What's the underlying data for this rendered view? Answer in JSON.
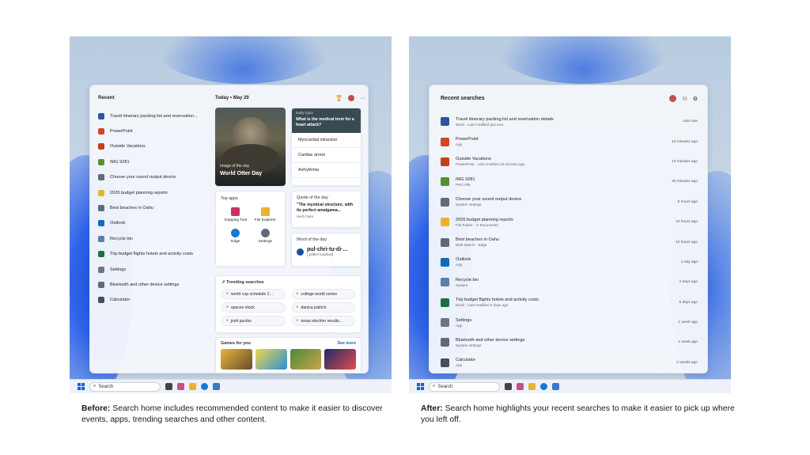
{
  "left": {
    "recent_header": "Recent",
    "recent_items": [
      {
        "label": "Travel itinerary packing list and reservation...",
        "icon": "word-doc-icon",
        "color": "#2b579a"
      },
      {
        "label": "PowerPoint",
        "icon": "powerpoint-icon",
        "color": "#d24726"
      },
      {
        "label": "Outside Vacations",
        "icon": "powerpoint-file-icon",
        "color": "#c43e1c"
      },
      {
        "label": "IMG 9281",
        "icon": "image-file-icon",
        "color": "#5b8c3a"
      },
      {
        "label": "Choose your sound output device",
        "icon": "speaker-icon",
        "color": "#5f6b7a"
      },
      {
        "label": "2026 budget planning reports",
        "icon": "folder-icon",
        "color": "#e8b42e"
      },
      {
        "label": "Best beaches in Oahu",
        "icon": "search-icon",
        "color": "#5f6b7a"
      },
      {
        "label": "Outlook",
        "icon": "outlook-icon",
        "color": "#0f6cbd"
      },
      {
        "label": "Recycle bin",
        "icon": "recycle-bin-icon",
        "color": "#5b7fa8"
      },
      {
        "label": "Trip budget flights hotels and activity costs",
        "icon": "excel-icon",
        "color": "#1d6f42"
      },
      {
        "label": "Settings",
        "icon": "gear-icon",
        "color": "#6b7785"
      },
      {
        "label": "Bluetooth and other device settings",
        "icon": "bluetooth-settings-icon",
        "color": "#5f6b7a"
      },
      {
        "label": "Calculator",
        "icon": "calculator-icon",
        "color": "#44505c"
      }
    ],
    "today_label": "Today",
    "date_sep": "•",
    "date": "May 29",
    "more_dots": "···",
    "otter": {
      "caption_small": "Image of the day",
      "caption_big": "World Otter Day"
    },
    "quiz": {
      "label": "Daily Quiz",
      "question": "What is the medical term for a heart attack?",
      "options": [
        "Myocardial infraction",
        "Cardiac arrest",
        "Arrhythmia"
      ]
    },
    "top_apps": {
      "header": "Top apps",
      "apps": [
        {
          "label": "Snipping Tool",
          "color": "#c9325c"
        },
        {
          "label": "File Explorer",
          "color": "#e8b42e"
        },
        {
          "label": "Edge",
          "color": "#1478d4"
        },
        {
          "label": "Settings",
          "color": "#5f6b7a"
        }
      ]
    },
    "quote": {
      "header": "Quote of the day",
      "text": "\"The mystical structure, with its perfect amalgama...",
      "author": "Herb Caen"
    },
    "word": {
      "header": "Word of the day",
      "word": "pul·chri·tu·di·...",
      "pron": "[ˌpəlkrəˈtoodnəs]"
    },
    "trending": {
      "header": "Trending searches",
      "items": [
        "world cup schedule 2...",
        "college world series",
        "spacex stock",
        "danica patrick",
        "josh jacobs",
        "texas election results..."
      ]
    },
    "games": {
      "header": "Games for you",
      "see_more": "See more"
    },
    "taskbar_search": "Search",
    "caption_bold": "Before:",
    "caption_text": " Search home includes recommended content to make it easier to discover events, apps, trending searches and other content."
  },
  "right": {
    "title": "Recent searches",
    "items": [
      {
        "name": "Travel itinerary packing list and reservation details",
        "sub": "Word · Last modified just now",
        "time": "Just now",
        "color": "#2b579a"
      },
      {
        "name": "PowerPoint",
        "sub": "App",
        "time": "10 minutes ago",
        "color": "#d24726"
      },
      {
        "name": "Outside Vacations",
        "sub": "PowerPoint · Last modified 10 minutes ago",
        "time": "10 minutes ago",
        "color": "#c43e1c"
      },
      {
        "name": "IMG 9281",
        "sub": "PNG File",
        "time": "20 minutes ago",
        "color": "#5b8c3a"
      },
      {
        "name": "Choose your sound output device",
        "sub": "System settings",
        "time": "5 hours ago",
        "color": "#5f6b7a"
      },
      {
        "name": "2026 budget planning reports",
        "sub": "File Folder · in Documents",
        "time": "10 hours ago",
        "color": "#e8b42e"
      },
      {
        "name": "Best beaches in Oahu",
        "sub": "Web search · Edge",
        "time": "10 hours ago",
        "color": "#5f6b7a"
      },
      {
        "name": "Outlook",
        "sub": "App",
        "time": "1 day ago",
        "color": "#0f6cbd"
      },
      {
        "name": "Recycle bin",
        "sub": "System",
        "time": "2 days ago",
        "color": "#5b7fa8"
      },
      {
        "name": "Trip budget flights hotels and activity costs",
        "sub": "Excel · Last modified 5 days ago",
        "time": "5 days ago",
        "color": "#1d6f42"
      },
      {
        "name": "Settings",
        "sub": "App",
        "time": "1 week ago",
        "color": "#6b7785"
      },
      {
        "name": "Bluetooth and other device settings",
        "sub": "System settings",
        "time": "1 week ago",
        "color": "#5f6b7a"
      },
      {
        "name": "Calculator",
        "sub": "App",
        "time": "2 weeks ago",
        "color": "#44505c"
      }
    ],
    "taskbar_search": "Search",
    "caption_bold": "After:",
    "caption_text": " Search home highlights your recent searches to make it easier to pick up where you left off."
  }
}
